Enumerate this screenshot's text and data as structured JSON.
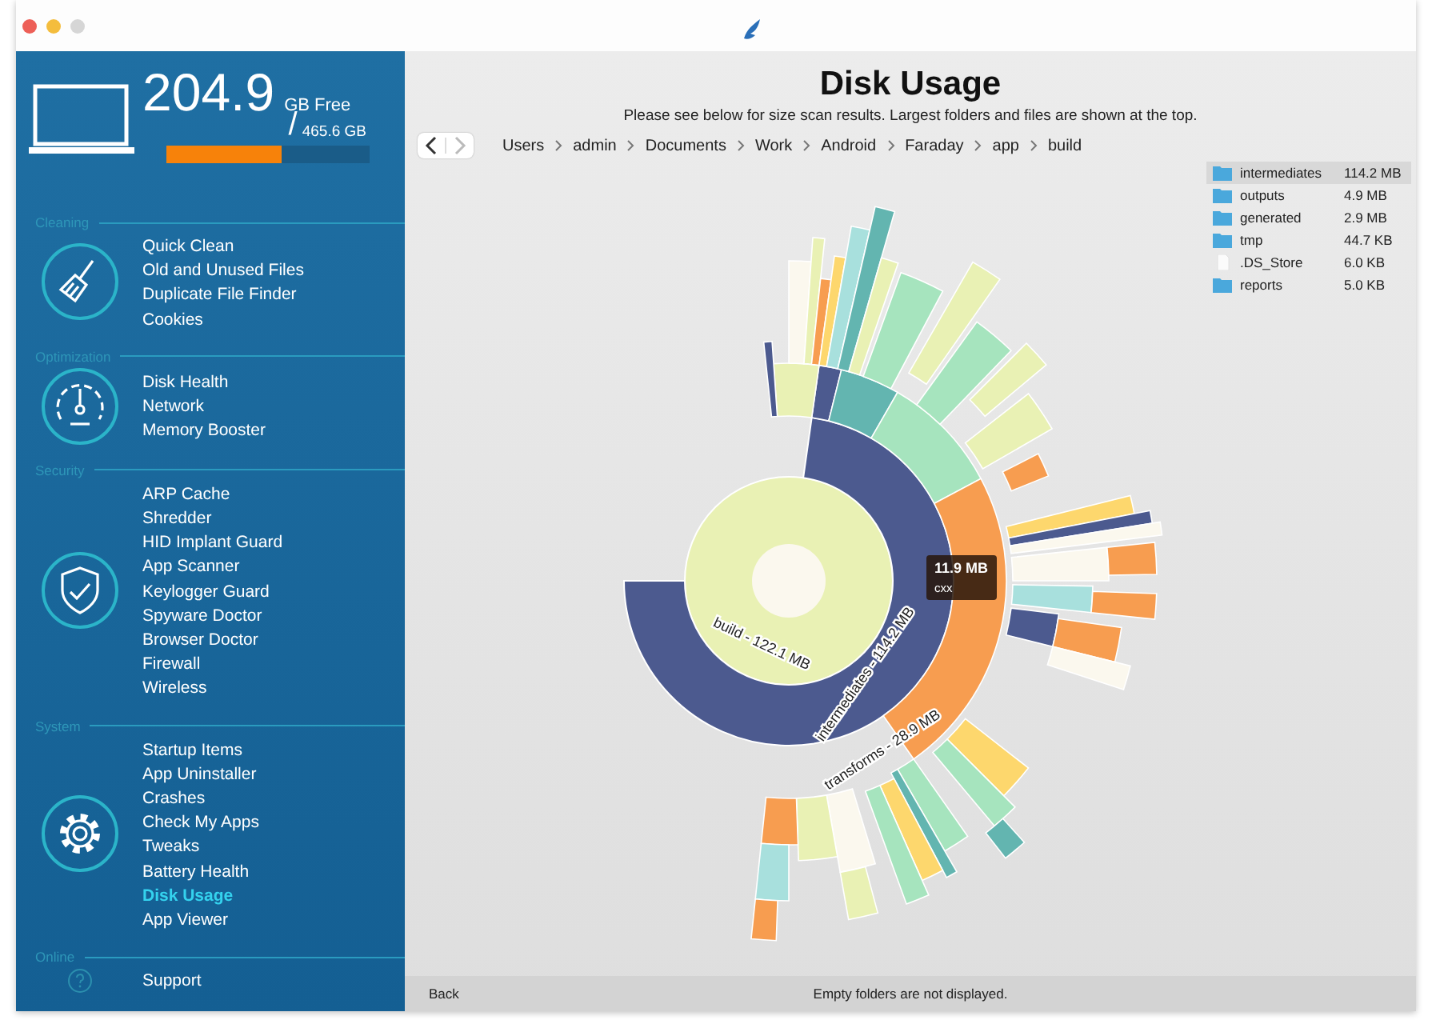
{
  "sidebar": {
    "disk": {
      "free": "204.9",
      "free_unit": "GB Free",
      "separator": "/",
      "total": "465.6 GB",
      "level": 0.57
    },
    "sections": [
      {
        "label": "Cleaning",
        "kind": "broom",
        "items": [
          {
            "label": "Quick Clean",
            "selected": false
          },
          {
            "label": "Old and Unused Files",
            "selected": false
          },
          {
            "label": "Duplicate File Finder",
            "selected": false
          },
          {
            "label": "Cookies",
            "selected": false
          }
        ]
      },
      {
        "label": "Optimization",
        "kind": "gauge",
        "items": [
          {
            "label": "Disk Health",
            "selected": false
          },
          {
            "label": "Network",
            "selected": false
          },
          {
            "label": "Memory Booster",
            "selected": false
          }
        ]
      },
      {
        "label": "Security",
        "kind": "shield",
        "items": [
          {
            "label": "ARP Cache",
            "selected": false
          },
          {
            "label": "Shredder",
            "selected": false
          },
          {
            "label": "HID Implant Guard",
            "selected": false
          },
          {
            "label": "App Scanner",
            "selected": false
          },
          {
            "label": "Keylogger Guard",
            "selected": false
          },
          {
            "label": "Spyware Doctor",
            "selected": false
          },
          {
            "label": "Browser Doctor",
            "selected": false
          },
          {
            "label": "Firewall",
            "selected": false
          },
          {
            "label": "Wireless",
            "selected": false
          }
        ]
      },
      {
        "label": "System",
        "kind": "gear",
        "items": [
          {
            "label": "Startup Items",
            "selected": false
          },
          {
            "label": "App Uninstaller",
            "selected": false
          },
          {
            "label": "Crashes",
            "selected": false
          },
          {
            "label": "Check My Apps",
            "selected": false
          },
          {
            "label": "Tweaks",
            "selected": false
          },
          {
            "label": "Battery Health",
            "selected": false
          },
          {
            "label": "Disk Usage",
            "selected": true
          },
          {
            "label": "App Viewer",
            "selected": false
          }
        ]
      },
      {
        "label": "Online",
        "kind": "help",
        "items": [
          {
            "label": "Support",
            "selected": false
          }
        ]
      }
    ]
  },
  "main": {
    "title": "Disk Usage",
    "subtitle": "Please see below for size scan results.  Largest folders and files are shown at the top.",
    "breadcrumbs": [
      "Users",
      "admin",
      "Documents",
      "Work",
      "Android",
      "Faraday",
      "app",
      "build"
    ],
    "files": [
      {
        "kind": "folder",
        "name": "intermediates",
        "size": "114.2 MB",
        "selected": true
      },
      {
        "kind": "folder",
        "name": "outputs",
        "size": "4.9 MB",
        "selected": false
      },
      {
        "kind": "folder",
        "name": "generated",
        "size": "2.9 MB",
        "selected": false
      },
      {
        "kind": "folder",
        "name": "tmp",
        "size": "44.7 KB",
        "selected": false
      },
      {
        "kind": "file",
        "name": ".DS_Store",
        "size": "6.0 KB",
        "selected": false
      },
      {
        "kind": "folder",
        "name": "reports",
        "size": "5.0 KB",
        "selected": false
      }
    ],
    "sunburst": {
      "labels": [
        "build - 122.1 MB",
        "intermediates - 114.2 MB",
        "transforms - 28.9 MB"
      ],
      "tooltip": {
        "size": "11.9 MB",
        "name": "cxx"
      }
    },
    "back": "Back",
    "note": "Empty folders are not displayed."
  }
}
